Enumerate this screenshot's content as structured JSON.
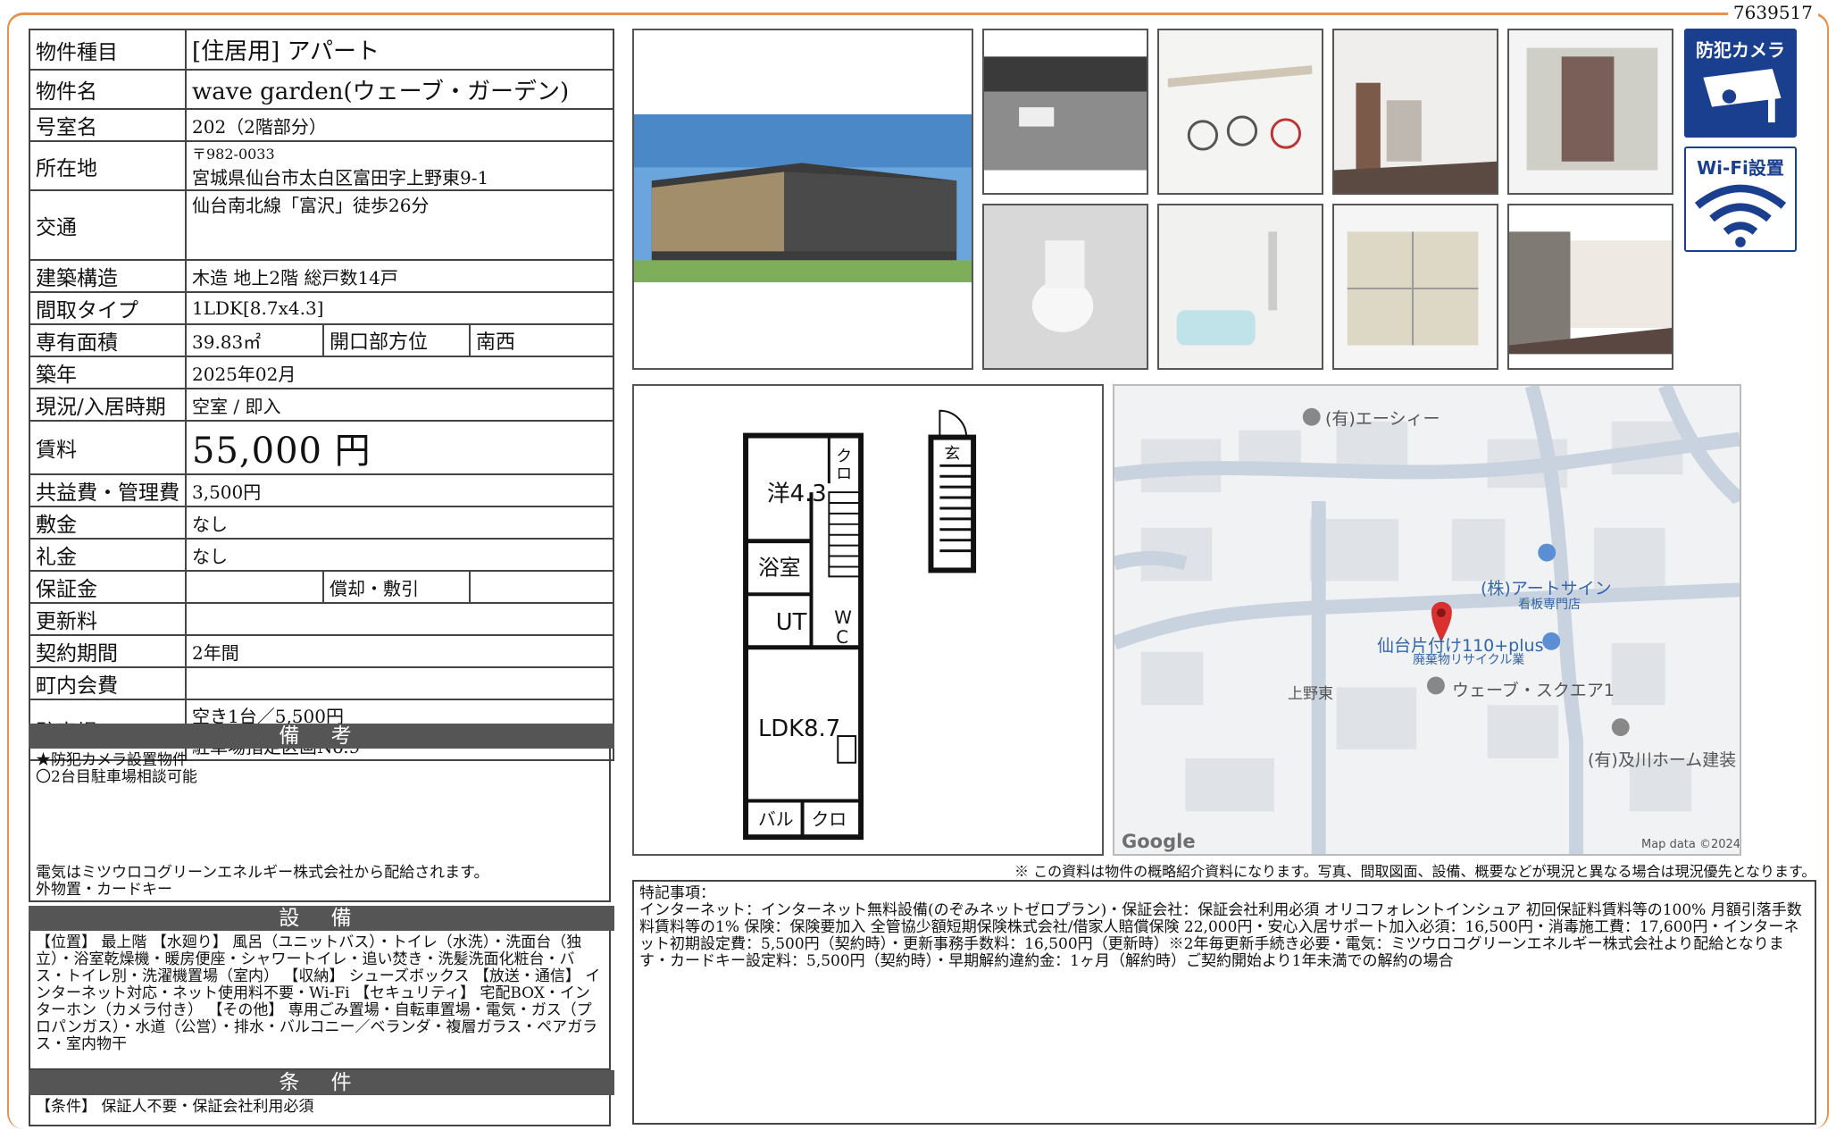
{
  "doc_id": "7639517",
  "spec": {
    "type_label": "物件種目",
    "type_value": "[住居用] アパート",
    "name_label": "物件名",
    "name_value": "wave garden(ウェーブ・ガーデン)",
    "room_label": "号室名",
    "room_value": "202（2階部分）",
    "address_label": "所在地",
    "postal": "〒982-0033",
    "address_value": "宮城県仙台市太白区富田字上野東9-1",
    "transport_label": "交通",
    "transport_value": "仙台南北線「富沢」徒歩26分",
    "structure_label": "建築構造",
    "structure_value": "木造 地上2階 総戸数14戸",
    "layout_label": "間取タイプ",
    "layout_value": "1LDK[8.7x4.3]",
    "area_label": "専有面積",
    "area_value": "39.83㎡",
    "direction_label": "開口部方位",
    "direction_value": "南西",
    "built_label": "築年",
    "built_value": "2025年02月",
    "status_label": "現況/入居時期",
    "status_value": "空室 / 即入",
    "rent_label": "賃料",
    "rent_value": "55,000 円",
    "fee_label": "共益費・管理費",
    "fee_value": "3,500円",
    "deposit_label": "敷金",
    "deposit_value": "なし",
    "key_money_label": "礼金",
    "key_money_value": "なし",
    "guarantee_label": "保証金",
    "guarantee_value": "",
    "amort_label": "償却・敷引",
    "amort_value": "",
    "renewal_label": "更新料",
    "renewal_value": "",
    "contract_label": "契約期間",
    "contract_value": "2年間",
    "neighborhood_label": "町内会費",
    "neighborhood_value": "",
    "parking_label": "駐車場",
    "parking_value1": "空き1台／5,500円",
    "parking_value2": "駐車場指定区画No.9"
  },
  "remarks_section": {
    "title": "備 考",
    "line1": "★防犯カメラ設置物件",
    "line2": "〇2台目駐車場相談可能",
    "line3": "電気はミツウロコグリーンエネルギー株式会社から配給されます。",
    "line4": "外物置・カードキー"
  },
  "equipment_section": {
    "title": "設 備",
    "text": "【位置】 最上階 【水廻り】 風呂（ユニットバス）・トイレ（水洗）・洗面台（独立）・浴室乾燥機・暖房便座・シャワートイレ・追い焚き・洗髪洗面化粧台・バス・トイレ別・洗濯機置場（室内） 【収納】 シューズボックス 【放送・通信】 インターネット対応・ネット使用料不要・Wi-Fi 【セキュリティ】 宅配BOX・インターホン（カメラ付き） 【その他】 専用ごみ置場・自転車置場・電気・ガス（プロパンガス）・水道（公営）・排水・バルコニー／ベランダ・複層ガラス・ペアガラス・室内物干"
  },
  "conditions_section": {
    "title": "条 件",
    "text": "【条件】 保証人不要・保証会社利用必須"
  },
  "floorplan": {
    "room_western": "洋4.3",
    "bath": "浴室",
    "ut": "UT",
    "wc_top": "W",
    "wc_bottom": "C",
    "ldk": "LDK8.7",
    "closet_top1": "ク",
    "closet_top2": "ロ",
    "entrance": "玄",
    "balcony": "バル",
    "closet_bottom": "クロ"
  },
  "map": {
    "place1": "(有)エーシィー",
    "place2": "(株)アートサイン",
    "place2_sub": "看板専門店",
    "place3": "仙台片付け110+plus",
    "place3_sub": "廃棄物リサイクル業",
    "area": "上野東",
    "place4": "ウェーブ・スクエア1",
    "place5": "(有)及川ホーム建装",
    "google": "Google",
    "copyright": "Map data ©2024"
  },
  "disclaimer": "※ この資料は物件の概略紹介資料になります。写真、間取図面、設備、概要などが現況と異なる場合は現況優先となります。",
  "special_notes": {
    "heading": "特記事項：",
    "text": "インターネット：インターネット無料設備(のぞみネットゼロプラン)・保証会社：保証会社利用必須 オリコフォレントインシュア 初回保証料賃料等の100% 月額引落手数料賃料等の1% 保険：保険要加入 全管協少額短期保険株式会社/借家人賠償保険 22,000円・安心入居サポート加入必須：16,500円・消毒施工費：17,600円・インターネット初期設定費：5,500円（契約時）・更新事務手数料：16,500円（更新時）※2年毎更新手続き必要・電気：ミツウロコグリーンエネルギー株式会社より配給となります・カードキー設定料：5,500円（契約時）・早期解約違約金：1ヶ月（解約時）ご契約開始より1年未満での解約の場合"
  },
  "badges": {
    "camera": "防犯カメラ",
    "wifi": "Wi-Fi設置"
  },
  "colors": {
    "frame": "#e8904a",
    "section_bar": "#555555",
    "badge": "#1a3f8f",
    "map_pin": "#d93030"
  }
}
